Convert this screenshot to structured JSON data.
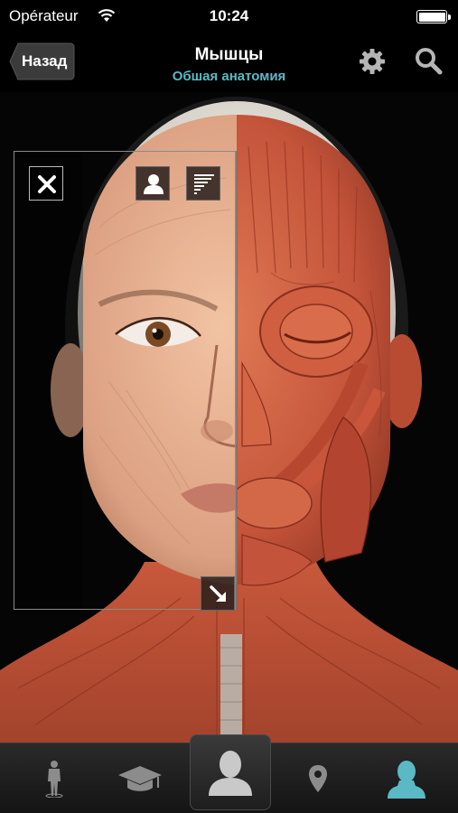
{
  "status_bar": {
    "carrier": "Opérateur",
    "time": "10:24"
  },
  "nav": {
    "back_label": "Назад",
    "title": "Мышцы",
    "subtitle": "Обшая анатомия"
  },
  "colors": {
    "accent": "#5bb9c6",
    "muscle": "#c8563a",
    "skin": "#e8b493"
  },
  "icons": {
    "settings": "gear-icon",
    "search": "search-icon",
    "close": "close-icon",
    "silhouette": "person-silhouette-icon",
    "layers": "layers-icon",
    "resize": "resize-arrow-icon"
  },
  "tab_bar": {
    "tabs": [
      {
        "icon": "full-body-icon",
        "selected": false
      },
      {
        "icon": "graduation-cap-icon",
        "selected": false
      },
      {
        "icon": "head-silhouette-icon",
        "selected": true
      },
      {
        "icon": "map-pin-icon",
        "selected": false
      },
      {
        "icon": "bust-icon",
        "selected": false
      }
    ]
  }
}
